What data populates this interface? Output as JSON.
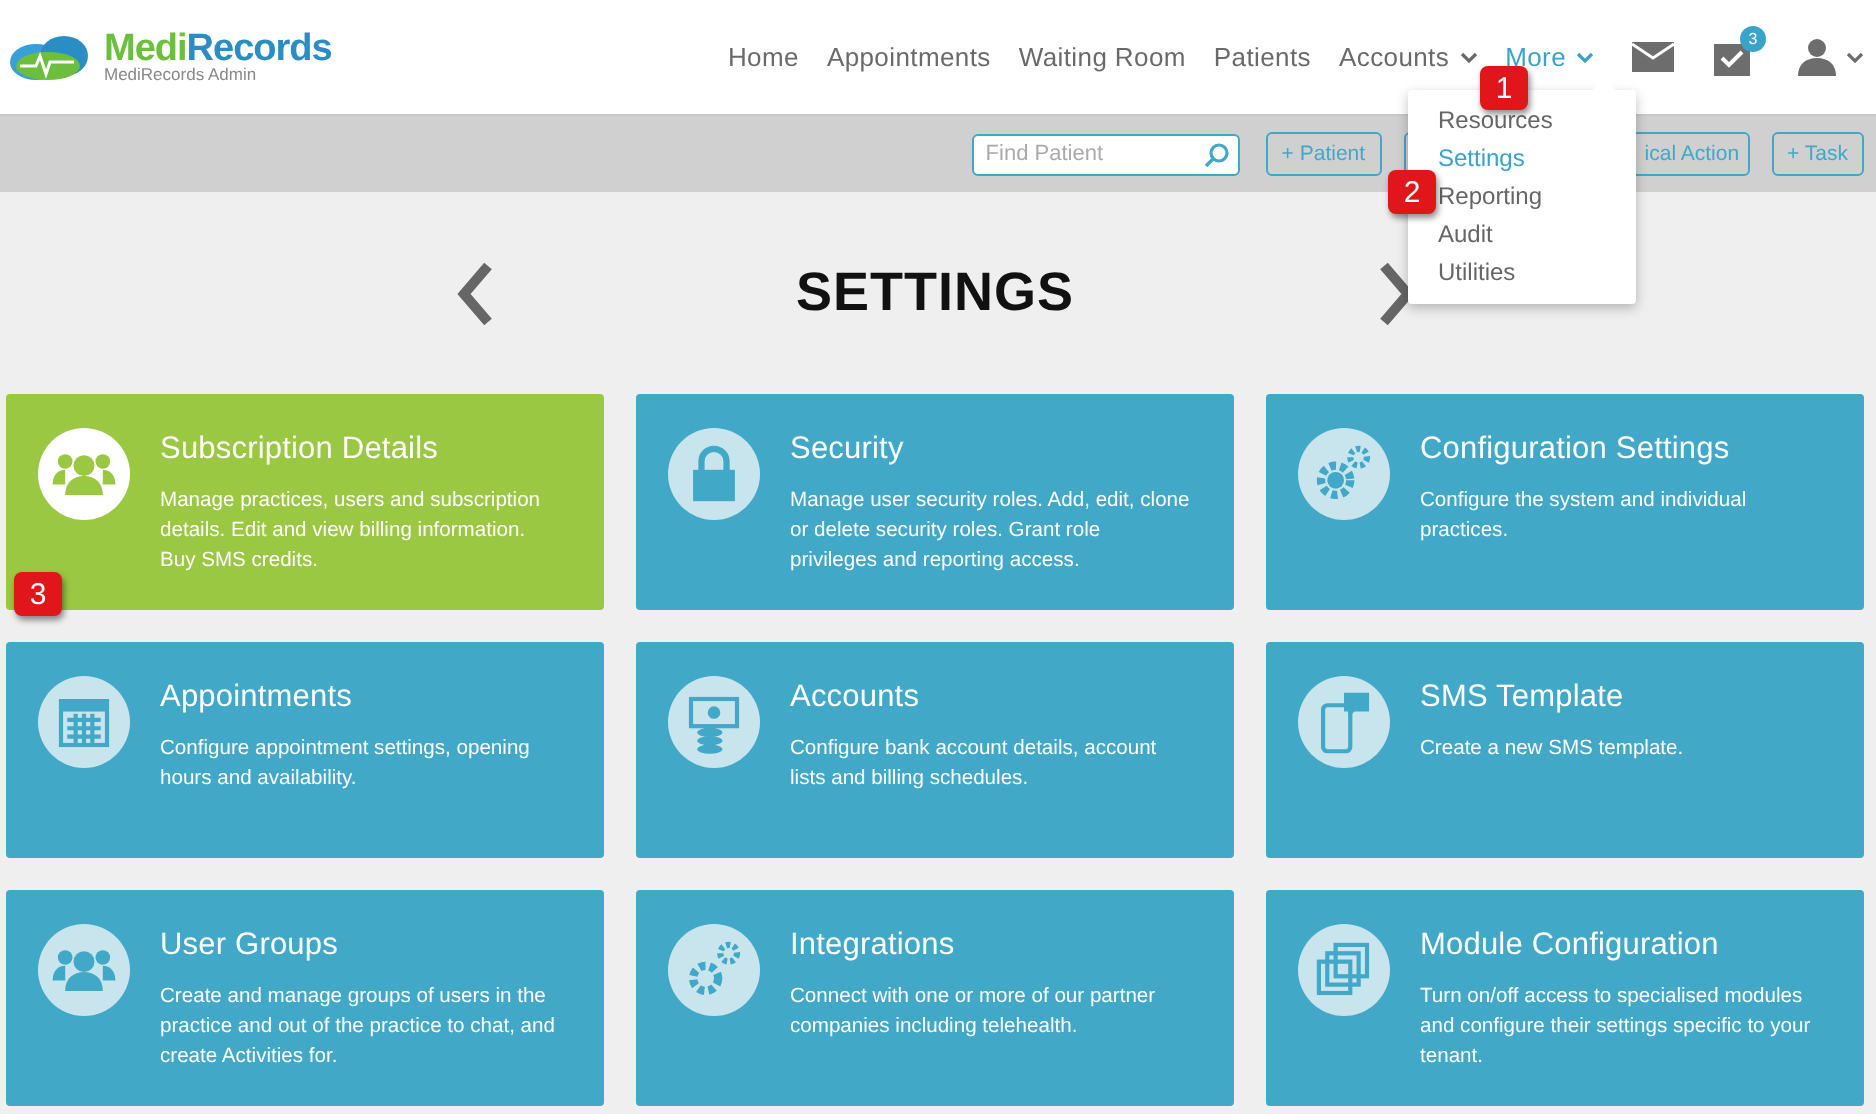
{
  "header": {
    "logo": {
      "brand_first": "Medi",
      "brand_second": "Records",
      "subtitle": "MediRecords Admin"
    },
    "nav": [
      {
        "label": "Home",
        "dropdown": false,
        "selected": false
      },
      {
        "label": "Appointments",
        "dropdown": false,
        "selected": false
      },
      {
        "label": "Waiting Room",
        "dropdown": false,
        "selected": false
      },
      {
        "label": "Patients",
        "dropdown": false,
        "selected": false
      },
      {
        "label": "Accounts",
        "dropdown": true,
        "selected": false
      },
      {
        "label": "More",
        "dropdown": true,
        "selected": true
      }
    ],
    "tasks_badge": "3"
  },
  "toolbar": {
    "search": {
      "placeholder": "Find Patient"
    },
    "buttons": [
      {
        "label": "+ Patient"
      },
      {
        "label": "ical Action"
      },
      {
        "label": "+ Task"
      }
    ]
  },
  "dropdown": {
    "items": [
      {
        "label": "Resources",
        "selected": false
      },
      {
        "label": "Settings",
        "selected": true
      },
      {
        "label": "Reporting",
        "selected": false
      },
      {
        "label": "Audit",
        "selected": false
      },
      {
        "label": "Utilities",
        "selected": false
      }
    ]
  },
  "page": {
    "title": "SETTINGS"
  },
  "cards": [
    {
      "kind": "subscription",
      "title": "Subscription Details",
      "description": "Manage practices, users and subscription details. Edit and view billing information. Buy SMS credits.",
      "color": "#9bc843"
    },
    {
      "kind": "security",
      "title": "Security",
      "description": "Manage user security roles. Add, edit, clone or delete security roles. Grant role privileges and reporting access.",
      "color": "#41a8c8"
    },
    {
      "kind": "configuration",
      "title": "Configuration Settings",
      "description": "Configure the system and individual practices.",
      "color": "#41a8c8"
    },
    {
      "kind": "appointments",
      "title": "Appointments",
      "description": "Configure appointment settings, opening hours and availability.",
      "color": "#41a8c8"
    },
    {
      "kind": "accounts",
      "title": "Accounts",
      "description": "Configure bank account details, account lists and billing schedules.",
      "color": "#41a8c8"
    },
    {
      "kind": "sms",
      "title": "SMS Template",
      "description": "Create a new SMS template.",
      "color": "#41a8c8"
    },
    {
      "kind": "groups",
      "title": "User Groups",
      "description": "Create and manage groups of users in the practice and out of the practice to chat, and create Activities for.",
      "color": "#41a8c8"
    },
    {
      "kind": "integrations",
      "title": "Integrations",
      "description": "Connect with one or more of our partner companies including telehealth.",
      "color": "#41a8c8"
    },
    {
      "kind": "modules",
      "title": "Module Configuration",
      "description": "Turn on/off access to specialised modules and configure their settings specific to your tenant.",
      "color": "#41a8c8"
    }
  ],
  "callouts": [
    {
      "number": "1"
    },
    {
      "number": "2"
    },
    {
      "number": "3"
    }
  ]
}
